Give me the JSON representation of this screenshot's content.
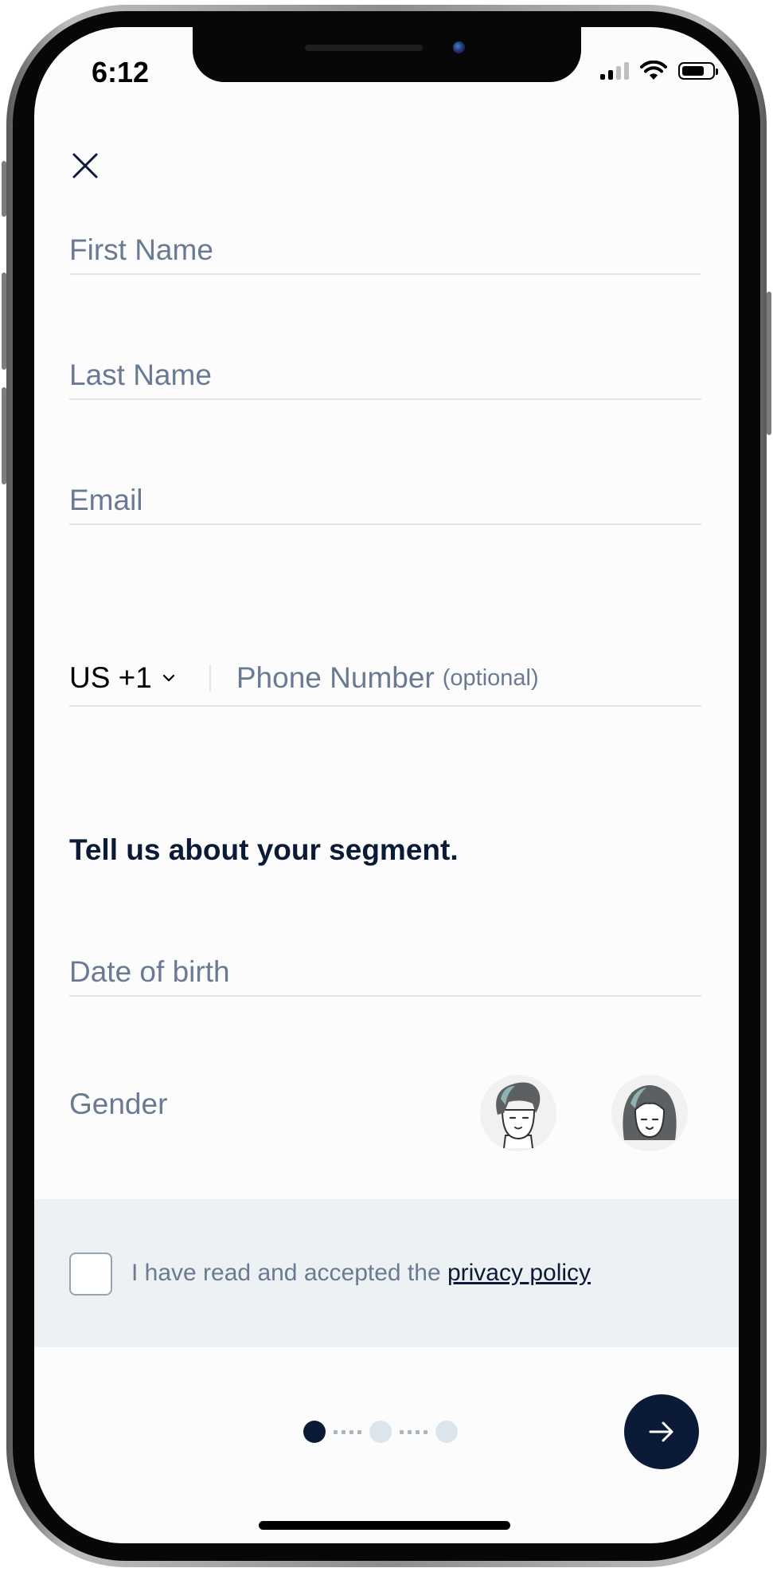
{
  "status_bar": {
    "time": "6:12",
    "icons": [
      "cellular-signal-icon",
      "wifi-icon",
      "battery-icon"
    ]
  },
  "header": {
    "close_icon": "close-icon"
  },
  "form": {
    "first_name_placeholder": "First Name",
    "last_name_placeholder": "Last Name",
    "email_placeholder": "Email",
    "country_code": "US +1",
    "country_chevron_icon": "chevron-down-icon",
    "phone_placeholder": "Phone Number",
    "phone_optional": "(optional)"
  },
  "segment": {
    "title": "Tell us about your segment.",
    "dob_placeholder": "Date of birth",
    "gender_label": "Gender",
    "gender_options": [
      "male-avatar-icon",
      "female-avatar-icon"
    ]
  },
  "consent": {
    "text": "I have read and accepted the ",
    "link": "privacy policy",
    "checked": false
  },
  "pagination": {
    "current": 1,
    "total": 3
  },
  "next_button": {
    "icon": "arrow-right-icon"
  },
  "colors": {
    "primary": "#0b1a36",
    "placeholder": "#6a7a92",
    "divider": "#dfe6ec",
    "consent_bg": "#edf1f4"
  }
}
